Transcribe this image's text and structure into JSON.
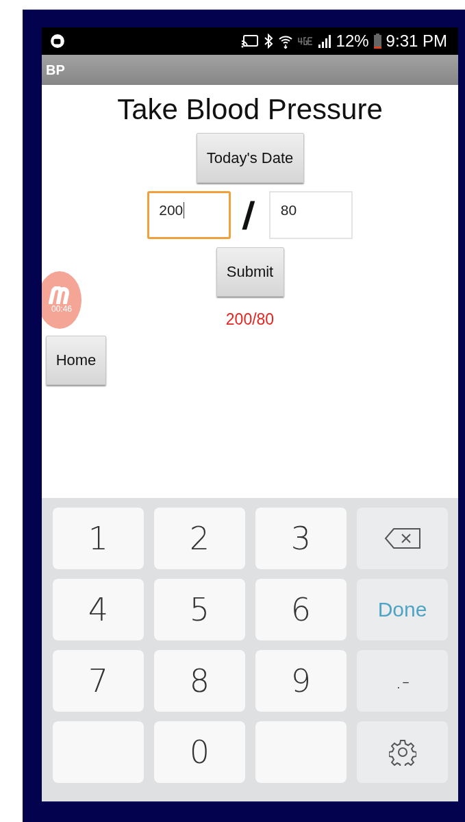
{
  "status_bar": {
    "battery": "12%",
    "time": "9:31 PM"
  },
  "app_bar": {
    "title": "BP"
  },
  "page": {
    "heading": "Take Blood Pressure",
    "date_button": "Today's Date",
    "systolic": {
      "value": "200",
      "focused": true
    },
    "separator": "/",
    "diastolic": {
      "value": "80",
      "focused": false
    },
    "submit_button": "Submit",
    "result": "200/80",
    "home_button": "Home"
  },
  "recorder": {
    "time": "00:46"
  },
  "keyboard": {
    "keys": [
      {
        "kind": "digit",
        "label": "1"
      },
      {
        "kind": "digit",
        "label": "2"
      },
      {
        "kind": "digit",
        "label": "3"
      },
      {
        "kind": "backspace"
      },
      {
        "kind": "digit",
        "label": "4"
      },
      {
        "kind": "digit",
        "label": "5"
      },
      {
        "kind": "digit",
        "label": "6"
      },
      {
        "kind": "done",
        "label": "Done"
      },
      {
        "kind": "digit",
        "label": "7"
      },
      {
        "kind": "digit",
        "label": "8"
      },
      {
        "kind": "digit",
        "label": "9"
      },
      {
        "kind": "symbol",
        "label": ".-"
      },
      {
        "kind": "blank"
      },
      {
        "kind": "digit",
        "label": "0"
      },
      {
        "kind": "blank"
      },
      {
        "kind": "settings"
      }
    ]
  }
}
